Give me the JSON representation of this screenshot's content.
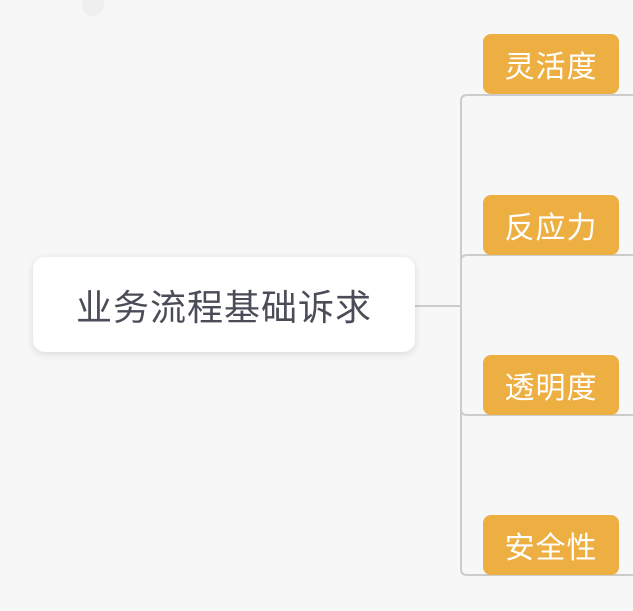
{
  "mindmap": {
    "root": {
      "label": "业务流程基础诉求"
    },
    "children": [
      {
        "label": "灵活度"
      },
      {
        "label": "反应力"
      },
      {
        "label": "透明度"
      },
      {
        "label": "安全性"
      }
    ]
  },
  "colors": {
    "background": "#f7f7f7",
    "root_fill": "#ffffff",
    "root_text": "#4a4d57",
    "child_fill": "#edae42",
    "child_text": "#ffffff",
    "connector": "#cccccc"
  }
}
